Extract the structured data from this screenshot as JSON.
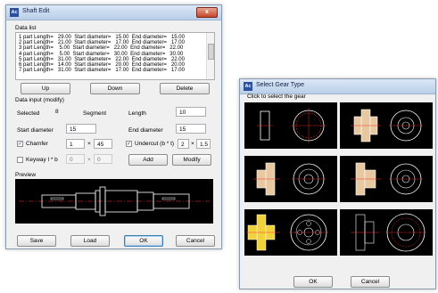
{
  "shaft_edit": {
    "title": "Shaft Edit",
    "app_icon_text": "Ac",
    "data_list": {
      "label": "Data list",
      "rows": [
        "1 part Length=   29.00  Start diameter=   15.00  End diameter=   15.00",
        "2 part Length=   21.00  Start diameter=   17.00  End diameter=   17.00",
        "3 part Length=    5.00  Start diameter=   22.00  End diameter=   22.00",
        "4 part Length=    5.00  Start diameter=   30.00  End diameter=   30.00",
        "5 part Length=   31.00  Start diameter=   22.00  End diameter=   22.00",
        "6 part Length=   14.00  Start diameter=   20.00  End diameter=   20.00",
        "7 part Length=   31.00  Start diameter=   17.00  End diameter=   17.00"
      ]
    },
    "buttons": {
      "up": "Up",
      "down": "Down",
      "delete": "Delete",
      "add": "Add",
      "modify": "Modify",
      "save": "Save",
      "load": "Load",
      "ok": "OK",
      "cancel": "Cancel"
    },
    "data_input": {
      "label": "Data input (modify)",
      "selected_label": "Selected",
      "selected_value": "8",
      "segment_label": "Segment",
      "length_label": "Length",
      "length_value": "10",
      "start_diameter_label": "Start diameter",
      "start_diameter_value": "15",
      "end_diameter_label": "End diameter",
      "end_diameter_value": "15",
      "chamfer_label": "Chamfer",
      "chamfer_checked": true,
      "chamfer_a": "1",
      "chamfer_sep": "×",
      "chamfer_b": "45",
      "undercut_label": "Undercut (b * t)",
      "undercut_checked": true,
      "undercut_b": "2",
      "undercut_sep": "×",
      "undercut_t": "1.5",
      "keyway_label": "Keyway l * b",
      "keyway_checked": false,
      "keyway_l": "0",
      "keyway_sep": "×",
      "keyway_b": "0"
    },
    "preview_label": "Preview"
  },
  "gear_type": {
    "title": "Select Gear Type",
    "app_icon_text": "Ac",
    "instruction": "Click to select the gear",
    "buttons": {
      "ok": "OK",
      "cancel": "Cancel"
    }
  },
  "colors": {
    "preview_bg": "#000000",
    "shaft_red": "#ff3030",
    "shaft_white": "#ffffff",
    "gear_yellow": "#f2d23a"
  },
  "close_glyph": "x",
  "check_glyph": "✓"
}
